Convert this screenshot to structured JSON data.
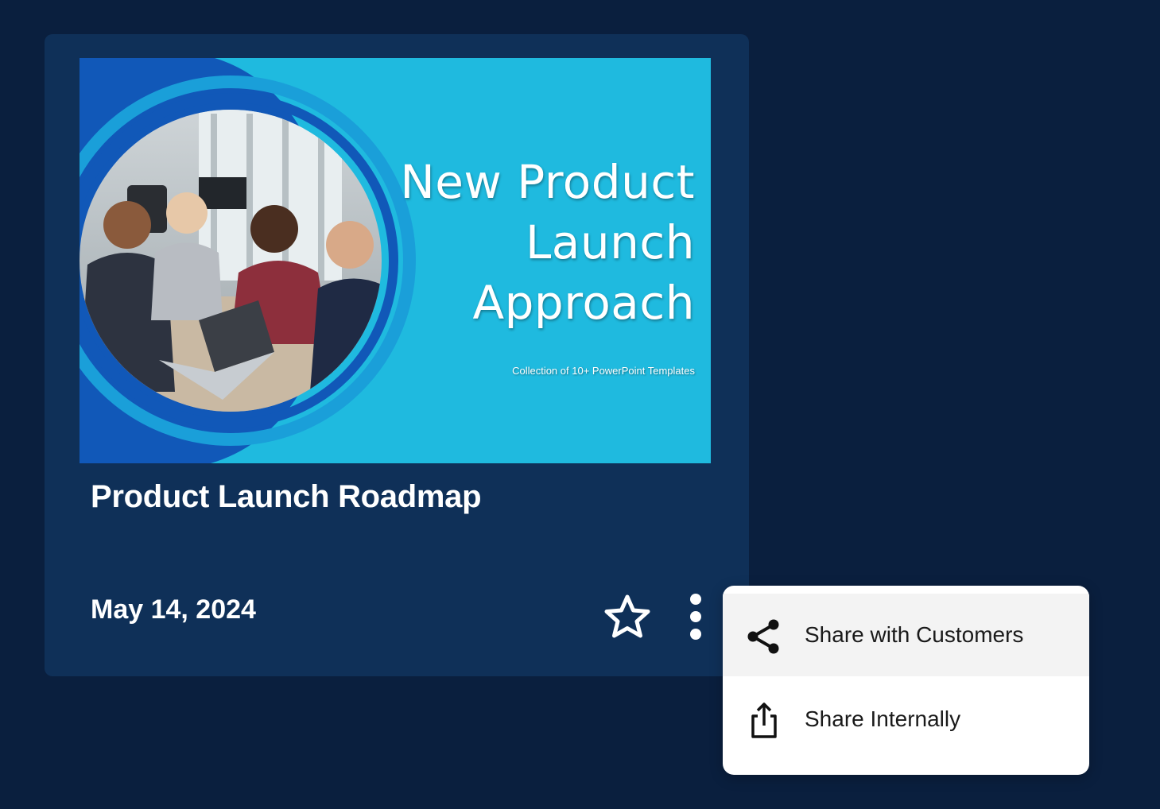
{
  "card": {
    "thumbnail": {
      "title_lines": [
        "New Product",
        "Launch",
        "Approach"
      ],
      "subtitle": "Collection of 10+ PowerPoint Templates"
    },
    "title": "Product Launch Roadmap",
    "date": "May 14, 2024",
    "favorite_icon": "star-outline-icon",
    "more_icon": "vertical-ellipsis-icon"
  },
  "share_menu": {
    "items": [
      {
        "label": "Share with Customers",
        "icon": "share-icon",
        "highlighted": true
      },
      {
        "label": "Share Internally",
        "icon": "upload-share-icon",
        "highlighted": false
      }
    ]
  },
  "colors": {
    "page_background": "#0a1f3e",
    "card_background": "#0f3058",
    "thumbnail_cyan": "#1fbadf",
    "thumbnail_blue": "#1158b8",
    "menu_background": "#ffffff",
    "menu_highlight": "#f3f3f3"
  }
}
